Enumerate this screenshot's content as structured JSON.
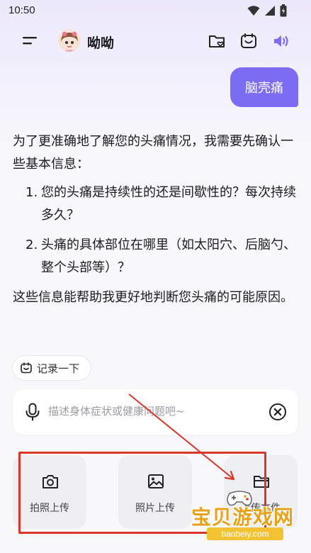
{
  "status": {
    "time": "10:50"
  },
  "header": {
    "title": "呦呦"
  },
  "chat": {
    "user_message": "脑壳痛",
    "reply": {
      "intro": "为了更准确地了解您的头痛情况，我需要先确认一些基本信息：",
      "items": [
        {
          "num": "1.",
          "text": "您的头痛是持续性的还是间歇性的？每次持续多久？"
        },
        {
          "num": "2.",
          "text": "头痛的具体部位在哪里（如太阳穴、后脑勺、整个头部等）？"
        }
      ],
      "outro": "这些信息能帮助我更好地判断您头痛的可能原因。"
    }
  },
  "record_chip": {
    "label": "记录一下"
  },
  "input": {
    "placeholder": "描述身体症状或健康问题吧~"
  },
  "tools": [
    {
      "label": "拍照上传",
      "icon": "camera-icon"
    },
    {
      "label": "照片上传",
      "icon": "image-icon"
    },
    {
      "label": "上传文件",
      "icon": "folder-icon"
    }
  ],
  "colors": {
    "accent": "#7c6cf2",
    "annotation": "#d8372a",
    "watermark": "#e8a21a"
  },
  "watermark": {
    "title": "宝贝游戏网",
    "url": "baobeiy.com"
  }
}
